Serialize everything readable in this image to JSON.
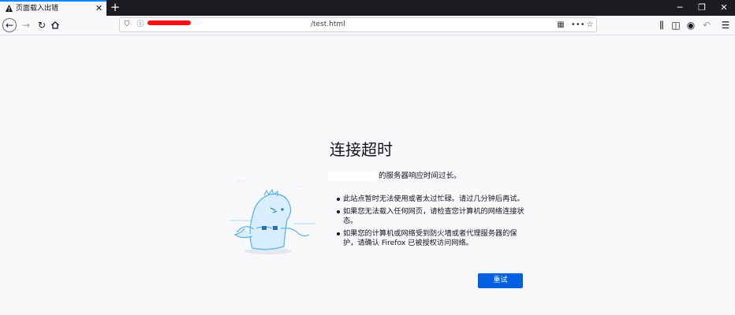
{
  "tab": {
    "title": "页面载入出错",
    "icon": "warning-icon"
  },
  "toolbar": {
    "url_suffix": "/test.html",
    "redacted_color": "#ff1010"
  },
  "error": {
    "title": "连接超时",
    "host_suffix": "的服务器响应时间过长。",
    "bullets": [
      "此站点暂时无法使用或者太过忙碌。请过几分钟后再试。",
      "如果您无法载入任何网页，请检查您计算机的网络连接状态。",
      "如果您的计算机或网络受到防火墙或者代理服务器的保护，请确认 Firefox 已被授权访问网络。"
    ],
    "retry_label": "重试"
  },
  "colors": {
    "accent": "#0060df",
    "tabstrip": "#1c1b22",
    "page_bg": "#f9f9fb"
  }
}
